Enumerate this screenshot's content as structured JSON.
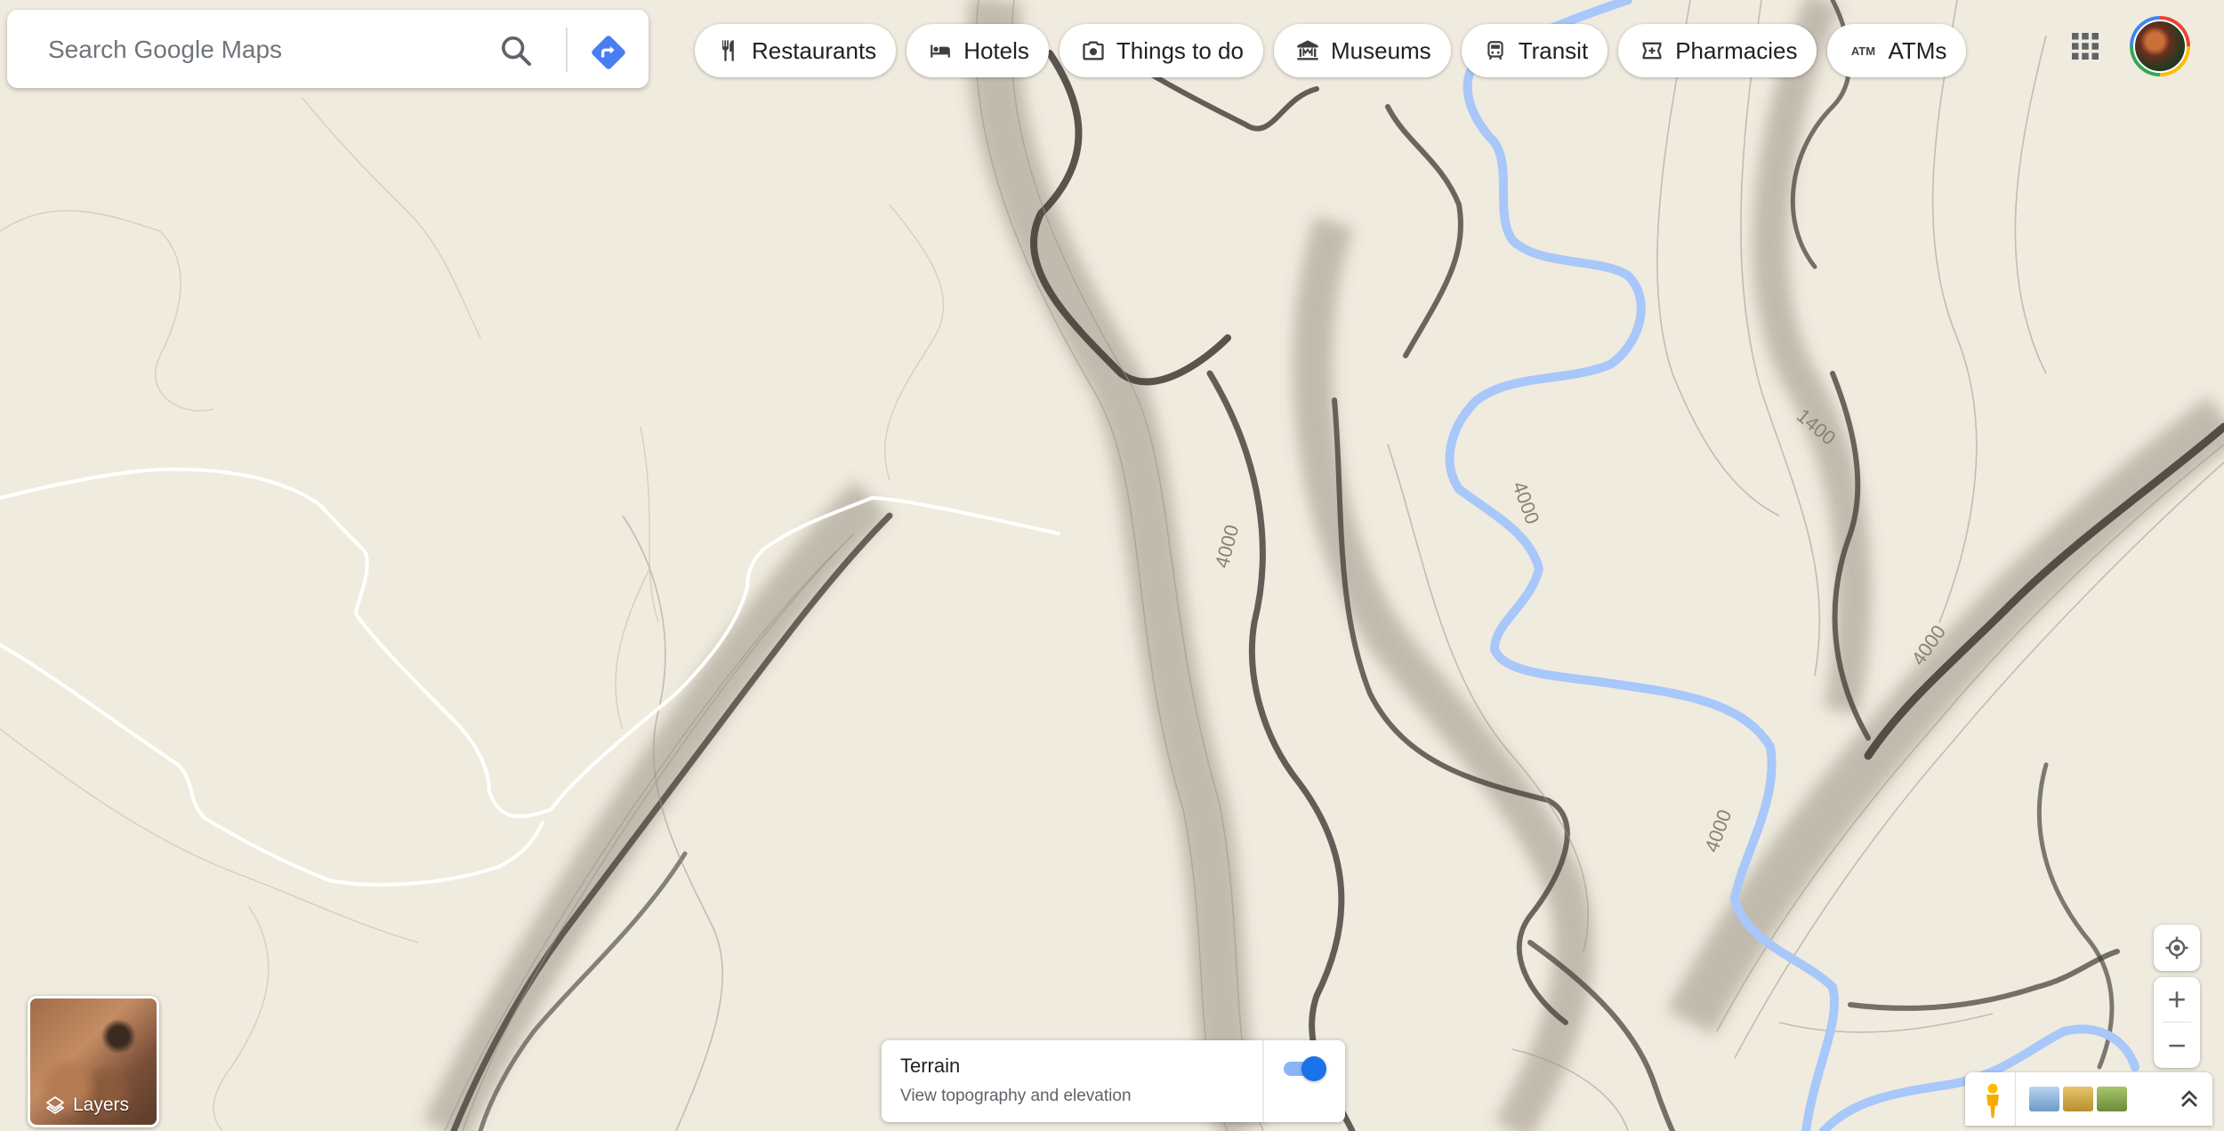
{
  "search": {
    "placeholder": "Search Google Maps"
  },
  "chips": [
    {
      "label": "Restaurants",
      "icon": "fork-knife-icon"
    },
    {
      "label": "Hotels",
      "icon": "bed-icon"
    },
    {
      "label": "Things to do",
      "icon": "camera-icon"
    },
    {
      "label": "Museums",
      "icon": "museum-icon"
    },
    {
      "label": "Transit",
      "icon": "train-icon"
    },
    {
      "label": "Pharmacies",
      "icon": "pharmacy-icon"
    },
    {
      "label": "ATMs",
      "icon": "atm-icon"
    }
  ],
  "atm_icon_text": "ATM",
  "map": {
    "contour_labels": [
      "4000",
      "4000",
      "1400",
      "4000",
      "4000"
    ],
    "river_color": "#a8c7fa",
    "land_color": "#efe9dc"
  },
  "layers": {
    "label": "Layers"
  },
  "terrain": {
    "title": "Terrain",
    "subtitle": "View topography and elevation",
    "enabled": true
  },
  "zoom": {
    "in": "+",
    "out": "−"
  }
}
